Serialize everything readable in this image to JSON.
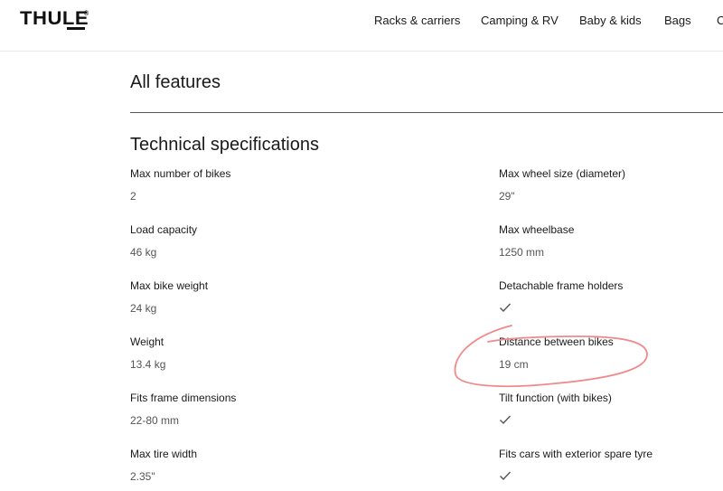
{
  "brand": {
    "logo_text": "THULE",
    "logo_mark": "®"
  },
  "nav": {
    "items": [
      {
        "label": "Racks & carriers"
      },
      {
        "label": "Camping & RV"
      },
      {
        "label": "Baby & kids"
      },
      {
        "label": "Bags"
      },
      {
        "label": "C"
      }
    ]
  },
  "main": {
    "all_features_label": "All features",
    "tech_specs_title": "Technical specifications",
    "specs_left": [
      {
        "label": "Max number of bikes",
        "value": "2"
      },
      {
        "label": "Load capacity",
        "value": "46 kg"
      },
      {
        "label": "Max bike weight",
        "value": "24 kg"
      },
      {
        "label": "Weight",
        "value": "13.4 kg"
      },
      {
        "label": "Fits frame dimensions",
        "value": "22-80 mm"
      },
      {
        "label": "Max tire width",
        "value": "2.35\""
      }
    ],
    "specs_right": [
      {
        "label": "Max wheel size (diameter)",
        "value": "29\""
      },
      {
        "label": "Max wheelbase",
        "value": "1250 mm"
      },
      {
        "label": "Detachable frame holders",
        "value": "",
        "icon": "checkmark-icon"
      },
      {
        "label": "Distance between bikes",
        "value": "19 cm"
      },
      {
        "label": "Tilt function (with bikes)",
        "value": "",
        "icon": "checkmark-icon"
      },
      {
        "label": "Fits cars with exterior spare tyre",
        "value": "",
        "icon": "checkmark-icon"
      }
    ]
  },
  "annotation": {
    "color": "#f08a8a",
    "icon": "hand-drawn-circle"
  }
}
